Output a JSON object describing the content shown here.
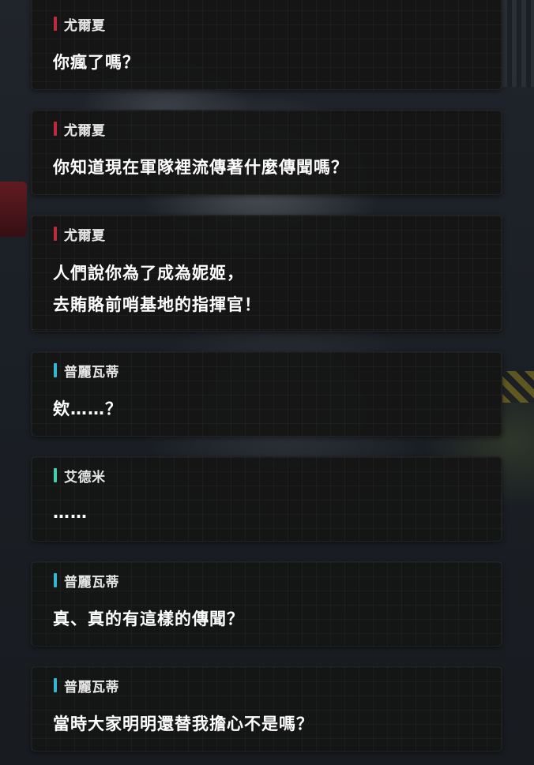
{
  "colors": {
    "speaker_red": "#c0283d",
    "speaker_cyan": "#33b5d6",
    "speaker_teal": "#3fd0b0",
    "card_bg": "#141414",
    "text": "#ffffff"
  },
  "dialogue": [
    {
      "speaker": "尤爾夏",
      "accent": "red",
      "lines": [
        "你瘋了嗎？"
      ]
    },
    {
      "speaker": "尤爾夏",
      "accent": "red",
      "lines": [
        "你知道現在軍隊裡流傳著什麼傳聞嗎？"
      ]
    },
    {
      "speaker": "尤爾夏",
      "accent": "red",
      "lines": [
        "人們說你為了成為妮姬，",
        "去賄賂前哨基地的指揮官！"
      ]
    },
    {
      "speaker": "普麗瓦蒂",
      "accent": "cyan",
      "lines": [
        "欸……？"
      ]
    },
    {
      "speaker": "艾德米",
      "accent": "teal",
      "lines": [
        "……"
      ]
    },
    {
      "speaker": "普麗瓦蒂",
      "accent": "cyan",
      "lines": [
        "真、真的有這樣的傳聞？"
      ]
    },
    {
      "speaker": "普麗瓦蒂",
      "accent": "cyan",
      "lines": [
        "當時大家明明還替我擔心不是嗎？"
      ]
    }
  ]
}
